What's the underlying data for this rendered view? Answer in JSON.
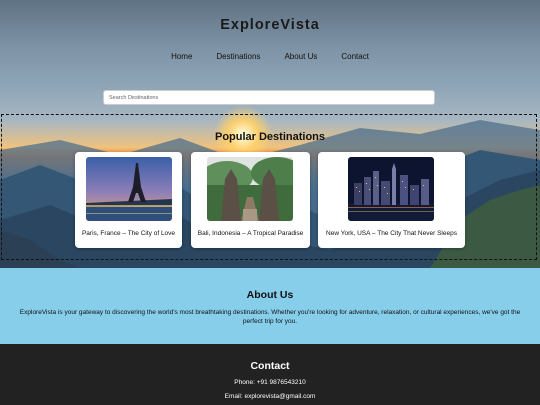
{
  "site": {
    "title": "ExploreVista"
  },
  "nav": [
    "Home",
    "Destinations",
    "About Us",
    "Contact"
  ],
  "search": {
    "placeholder": "Search Destinations",
    "value": ""
  },
  "destinations": {
    "title": "Popular Destinations",
    "cards": [
      {
        "caption": "Paris, France – The City of Love",
        "image_icon": "eiffel-tower-image"
      },
      {
        "caption": "Bali, Indonesia – A Tropical Paradise",
        "image_icon": "bali-temple-gate-image"
      },
      {
        "caption": "New York, USA – The City That Never Sleeps",
        "image_icon": "new-york-skyline-image"
      }
    ]
  },
  "about": {
    "title": "About Us",
    "text": "ExploreVista is your gateway to discovering the world's most breathtaking destinations. Whether you're looking for adventure, relaxation, or cultural experiences, we've got the perfect trip for you."
  },
  "contact": {
    "title": "Contact",
    "phone": "Phone: +91 9876543210",
    "email": "Email: explorevista@gmail.com"
  },
  "colors": {
    "about_bg": "#87ceeb",
    "contact_bg": "#222222"
  }
}
